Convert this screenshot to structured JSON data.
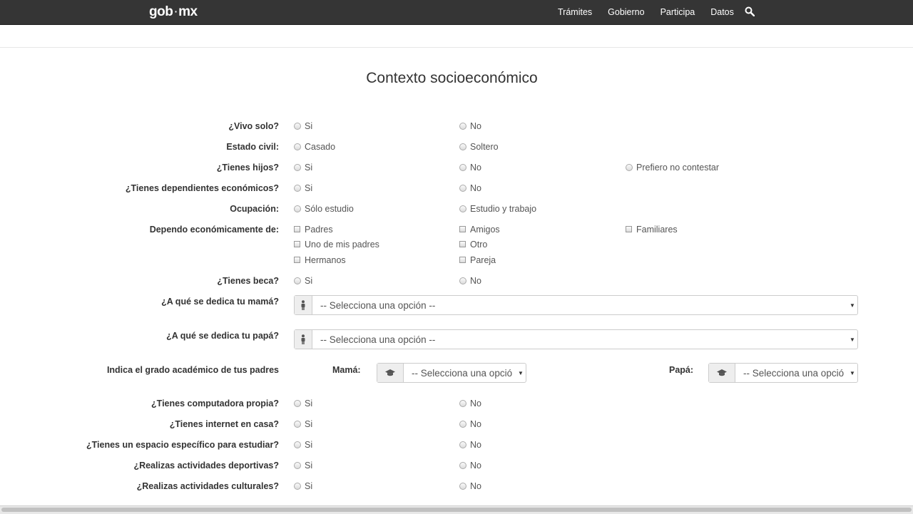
{
  "header": {
    "logo_left": "gob",
    "logo_right": "mx",
    "nav": [
      "Trámites",
      "Gobierno",
      "Participa",
      "Datos"
    ]
  },
  "title": "Contexto socioeconómico",
  "questions": {
    "vivo_solo": {
      "label": "¿Vivo solo?",
      "options": [
        "Si",
        "No"
      ]
    },
    "estado_civil": {
      "label": "Estado civil:",
      "options": [
        "Casado",
        "Soltero"
      ]
    },
    "hijos": {
      "label": "¿Tienes hijos?",
      "options": [
        "Si",
        "No",
        "Prefiero no contestar"
      ]
    },
    "dependientes": {
      "label": "¿Tienes dependientes económicos?",
      "options": [
        "Si",
        "No"
      ]
    },
    "ocupacion": {
      "label": "Ocupación:",
      "options": [
        "Sólo estudio",
        "Estudio y trabajo"
      ]
    },
    "depende": {
      "label": "Dependo económicamente de:",
      "options": [
        "Padres",
        "Amigos",
        "Familiares",
        "Uno de mis padres",
        "Otro",
        "Hermanos",
        "Pareja"
      ]
    },
    "beca": {
      "label": "¿Tienes beca?",
      "options": [
        "Si",
        "No"
      ]
    },
    "mama": {
      "label": "¿A qué se dedica tu mamá?",
      "select": "-- Selecciona una opción --"
    },
    "papa": {
      "label": "¿A qué se dedica tu papá?",
      "select": "-- Selecciona una opción --"
    },
    "grado": {
      "label": "Indica el grado académico de tus padres",
      "mama_label": "Mamá:",
      "papa_label": "Papá:",
      "mama_select": "-- Selecciona una opció",
      "papa_select": "-- Selecciona una opció"
    },
    "computadora": {
      "label": "¿Tienes computadora propia?",
      "options": [
        "Si",
        "No"
      ]
    },
    "internet": {
      "label": "¿Tienes internet en casa?",
      "options": [
        "Si",
        "No"
      ]
    },
    "espacio": {
      "label": "¿Tienes un espacio específico para estudiar?",
      "options": [
        "Si",
        "No"
      ]
    },
    "deportivas": {
      "label": "¿Realizas actividades deportivas?",
      "options": [
        "Si",
        "No"
      ]
    },
    "culturales": {
      "label": "¿Realizas actividades culturales?",
      "options": [
        "Si",
        "No"
      ]
    }
  },
  "icons": {
    "search": "search-icon",
    "person": "person-icon",
    "grad": "graduation-cap-icon"
  },
  "colors": {
    "topbar": "#353535",
    "text": "#555555",
    "label": "#333333"
  }
}
